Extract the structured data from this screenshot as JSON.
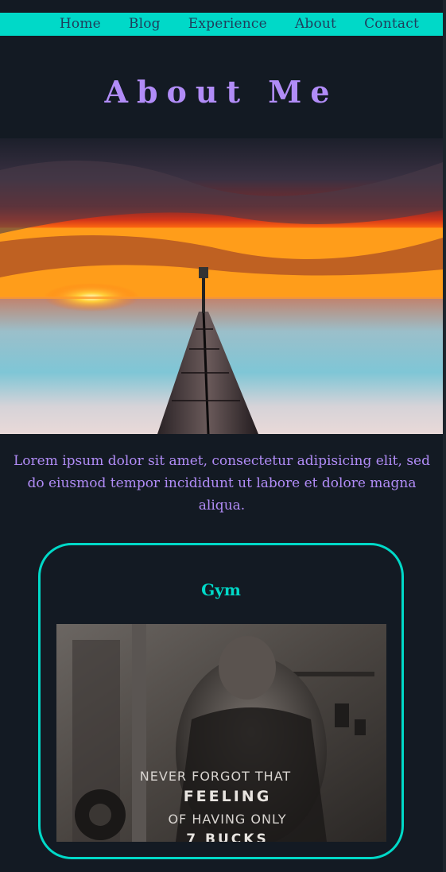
{
  "nav": {
    "items": [
      "Home",
      "Blog",
      "Experience",
      "About",
      "Contact"
    ]
  },
  "page": {
    "title": "About Me",
    "intro": "Lorem ipsum dolor sit amet, consectetur adipisicing elit, sed do eiusmod tempor incididunt ut labore et dolore magna aliqua."
  },
  "card": {
    "title": "Gym",
    "image_text": [
      "NEVER FORGOT THAT",
      "FEELING",
      "OF HAVING ONLY",
      "7 BUCKS"
    ]
  },
  "colors": {
    "background": "#131a23",
    "accent": "#00d9c8",
    "text": "#b18cf7",
    "nav_text": "#1f3d5c"
  }
}
